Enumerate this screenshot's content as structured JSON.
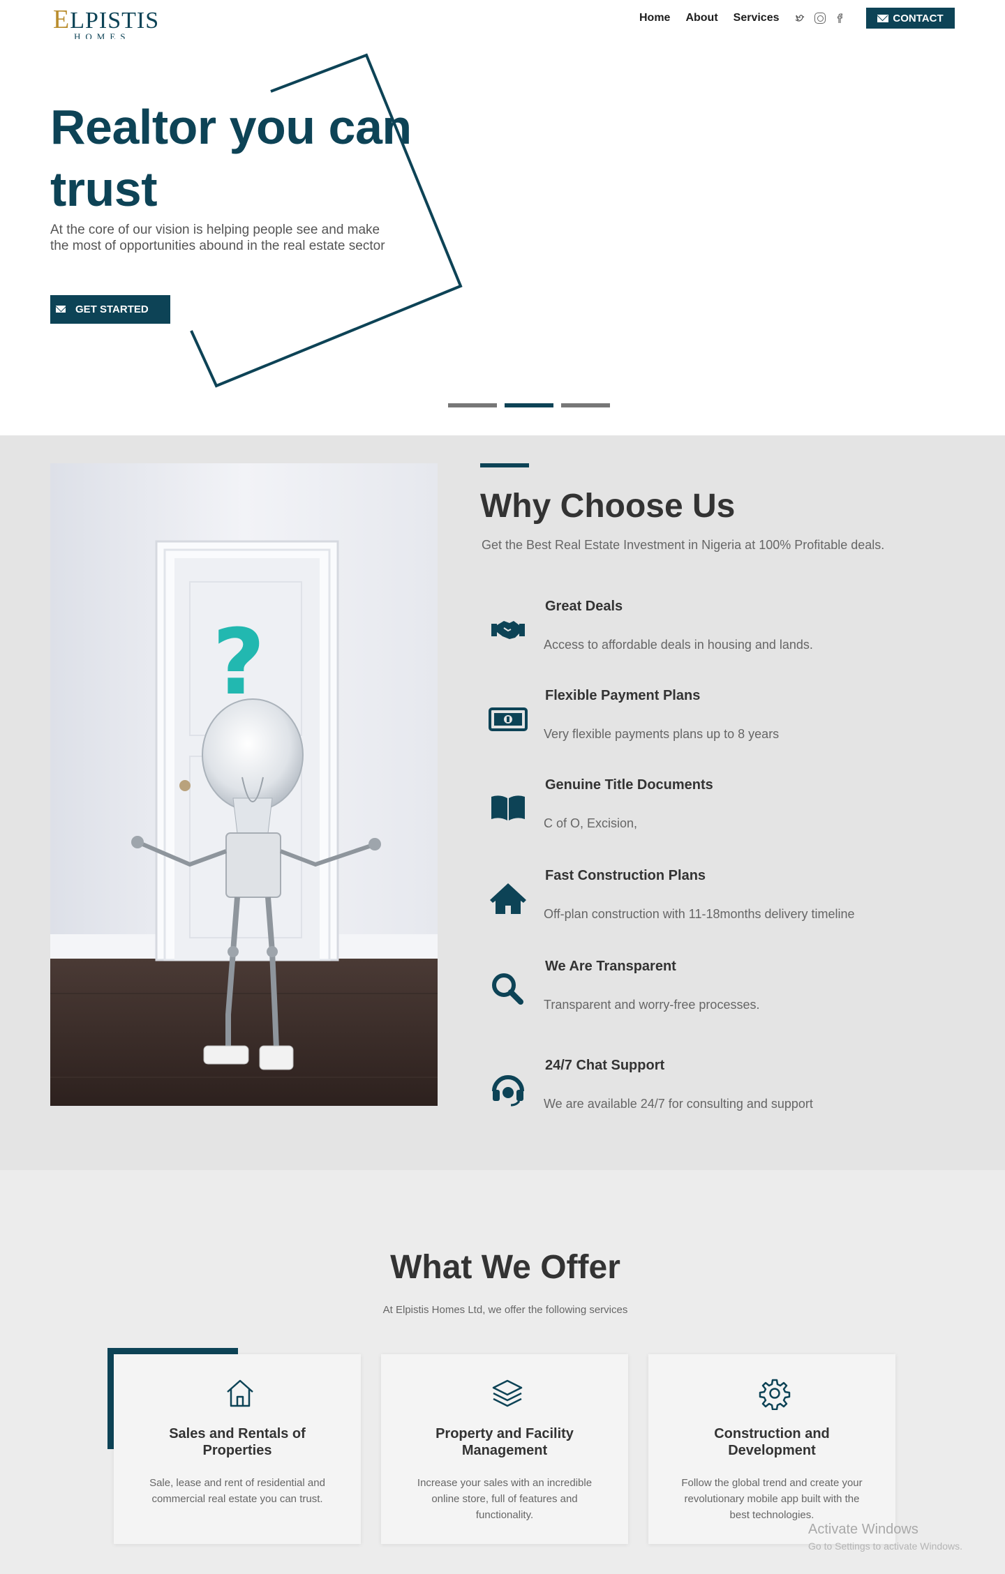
{
  "brand": {
    "logo_main": "LPISTIS",
    "logo_initial": "E",
    "logo_sub": "HOMES"
  },
  "nav": {
    "links": [
      "Home",
      "About",
      "Services"
    ],
    "social_icons": [
      "twitter-icon",
      "instagram-icon",
      "facebook-icon"
    ],
    "contact_label": "CONTACT"
  },
  "hero": {
    "title": "Realtor you can trust",
    "text": "At the core of our vision is helping people see and make the most of opportunities abound in the real estate sector",
    "button_label": "GET STARTED",
    "slides": 3,
    "active_slide": 2
  },
  "why": {
    "title": "Why Choose Us",
    "subtitle": "Get the Best Real Estate Investment in Nigeria at 100% Profitable deals.",
    "features": [
      {
        "icon": "handshake-icon",
        "title": "Great Deals",
        "desc": "Access to affordable deals in housing and lands."
      },
      {
        "icon": "money-bill-icon",
        "title": "Flexible Payment Plans",
        "desc": "Very flexible payments plans up to 8 years"
      },
      {
        "icon": "book-open-icon",
        "title": "Genuine Title Documents",
        "desc": "C of O, Excision,"
      },
      {
        "icon": "home-icon",
        "title": "Fast Construction Plans",
        "desc": "Off-plan construction with 11-18months delivery timeline"
      },
      {
        "icon": "search-icon",
        "title": "We Are Transparent",
        "desc": "Transparent and worry-free processes."
      },
      {
        "icon": "headset-icon",
        "title": "24/7 Chat Support",
        "desc": "We are available 24/7 for consulting and support"
      }
    ]
  },
  "offer": {
    "title": "What We Offer",
    "subtitle": "At Elpistis Homes Ltd, we offer the following services",
    "cards": [
      {
        "icon": "house-outline-icon",
        "title": "Sales and Rentals of Properties",
        "desc": "Sale, lease and rent of residential and commercial real estate you can trust."
      },
      {
        "icon": "layers-icon",
        "title": "Property and Facility Management",
        "desc": "Increase your sales with an incredible online store, full of features and functionality."
      },
      {
        "icon": "gear-icon",
        "title": "Construction and Development",
        "desc": "Follow the global trend and create your revolutionary mobile app built with the best technologies."
      }
    ]
  },
  "watermark": {
    "line1": "Activate Windows",
    "line2": "Go to Settings to activate Windows."
  },
  "colors": {
    "brand": "#0d4356",
    "gold": "#b98c2c",
    "section_gray": "#e4e4e4"
  }
}
